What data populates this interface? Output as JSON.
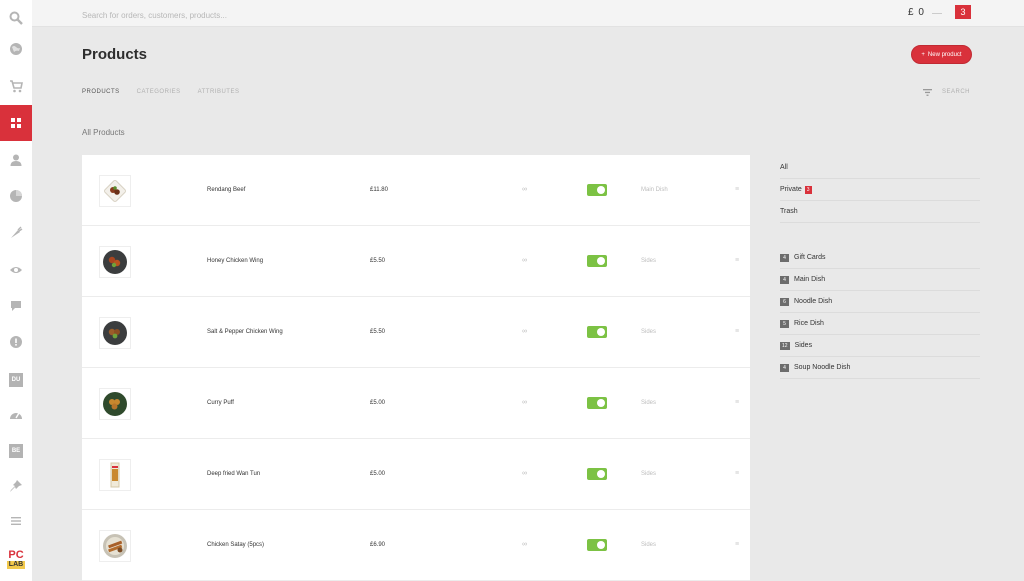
{
  "topbar": {
    "search_placeholder": "Search for orders, customers, products...",
    "cart_total": "£ 0",
    "cart_count": "3"
  },
  "sidebar": {
    "items": [
      {
        "name": "search",
        "icon": "search-icon"
      },
      {
        "name": "globe",
        "icon": "globe-icon"
      },
      {
        "name": "orders",
        "icon": "cart-icon"
      },
      {
        "name": "products",
        "icon": "grid-icon",
        "active": true
      },
      {
        "name": "customers",
        "icon": "user-icon"
      },
      {
        "name": "reports",
        "icon": "pie-chart-icon"
      },
      {
        "name": "marketing",
        "icon": "carrot-icon"
      },
      {
        "name": "visibility",
        "icon": "eye-icon"
      },
      {
        "name": "comments",
        "icon": "chat-icon"
      },
      {
        "name": "alerts",
        "icon": "alert-icon"
      },
      {
        "name": "du",
        "icon": "du-icon",
        "text": "DU"
      },
      {
        "name": "dashboard",
        "icon": "gauge-icon"
      },
      {
        "name": "be",
        "icon": "be-icon",
        "text": "BE"
      },
      {
        "name": "pin",
        "icon": "pin-icon"
      },
      {
        "name": "menu",
        "icon": "menu-icon"
      }
    ],
    "logo_top": "PC",
    "logo_bottom": "LAB"
  },
  "header": {
    "title": "Products",
    "new_button": "New product",
    "new_button_icon": "+",
    "tabs": [
      "PRODUCTS",
      "CATEGORIES",
      "ATTRIBUTES"
    ],
    "search_label": "SEARCH",
    "section_title": "All Products"
  },
  "products": [
    {
      "name": "Rendang Beef",
      "price": "£11.80",
      "stock": "∞",
      "category": "Main Dish",
      "thumb": "square"
    },
    {
      "name": "Honey Chicken Wing",
      "price": "£5.50",
      "stock": "∞",
      "category": "Sides",
      "thumb": "dark-plate"
    },
    {
      "name": "Salt & Pepper Chicken Wing",
      "price": "£5.50",
      "stock": "∞",
      "category": "Sides",
      "thumb": "dark-plate"
    },
    {
      "name": "Curry Puff",
      "price": "£5.00",
      "stock": "∞",
      "category": "Sides",
      "thumb": "dark-plate"
    },
    {
      "name": "Deep fried Wan Tun",
      "price": "£5.00",
      "stock": "∞",
      "category": "Sides",
      "thumb": "packet"
    },
    {
      "name": "Chicken Satay (5pcs)",
      "price": "£6.90",
      "stock": "∞",
      "category": "Sides",
      "thumb": "light-plate"
    }
  ],
  "filters": {
    "status": [
      {
        "label": "All"
      },
      {
        "label": "Private",
        "badge": "3"
      },
      {
        "label": "Trash"
      }
    ],
    "categories": [
      {
        "count": "4",
        "label": "Gift Cards"
      },
      {
        "count": "4",
        "label": "Main Dish"
      },
      {
        "count": "6",
        "label": "Noodle Dish"
      },
      {
        "count": "5",
        "label": "Rice Dish"
      },
      {
        "count": "12",
        "label": "Sides"
      },
      {
        "count": "4",
        "label": "Soup Noodle Dish"
      }
    ]
  },
  "colors": {
    "accent": "#d9313b",
    "toggle_on": "#7cc244",
    "background": "#e9e9e9"
  }
}
